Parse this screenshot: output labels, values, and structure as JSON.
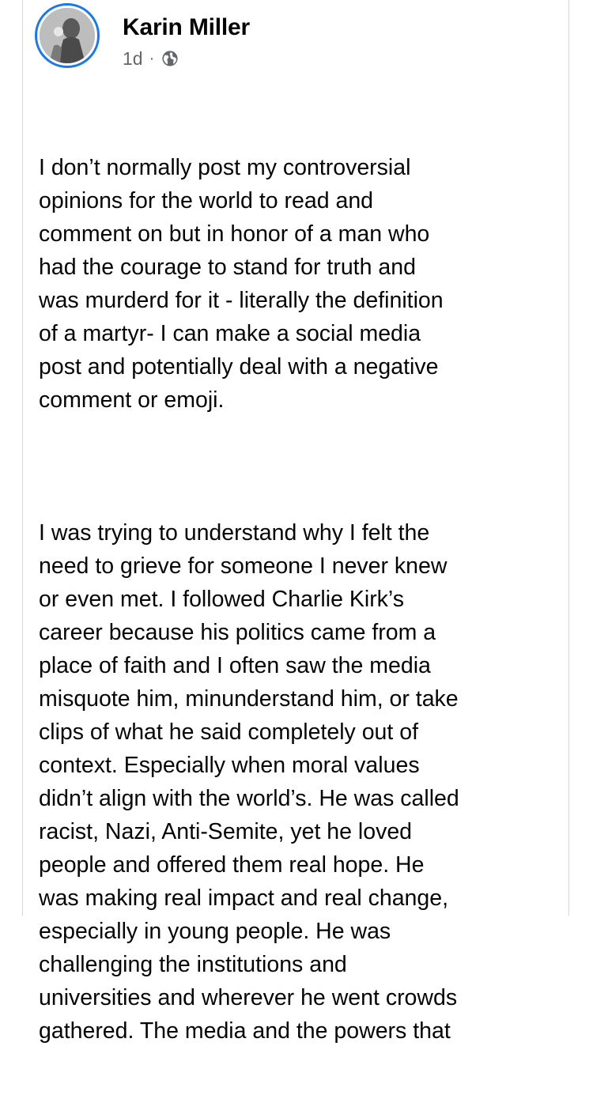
{
  "post": {
    "author": "Karin Miller",
    "timestamp": "1d",
    "separator": "·",
    "privacy_icon": "globe-icon",
    "paragraphs": [
      "I don’t normally post my controversial\nopinions for the world to read and\ncomment on but in honor of a man who\nhad the courage to stand for truth and\nwas murderd for it - literally the definition\nof a martyr- I can make a social media\npost and potentially deal with a negative\ncomment or emoji.",
      "I was trying to understand why I felt the\nneed to grieve for someone I never knew\nor even met. I followed Charlie Kirk’s\ncareer because his politics came from a\nplace of faith and I often saw the media\nmisquote him, minunderstand him, or take\nclips of what he said completely out of\ncontext. Especially when moral values\ndidn’t align with the world’s. He was called\nracist, Nazi, Anti-Semite, yet he loved\npeople and offered them real hope. He\nwas making real impact and real change,\nespecially in young people. He was\nchallenging the institutions and\nuniversities and wherever he went crowds\ngathered. The media and the powers that"
    ]
  },
  "colors": {
    "story_ring": "#1877f2",
    "text": "#050505",
    "meta_text": "#65676b",
    "card_border": "#d6d6d6"
  }
}
